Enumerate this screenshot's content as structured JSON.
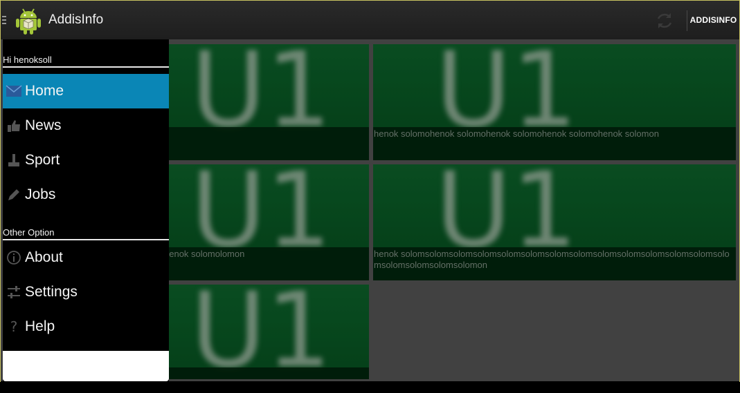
{
  "app": {
    "title": "AddisInfo",
    "action_button": "ADDISINFO"
  },
  "drawer": {
    "greeting": "Hi henoksoll",
    "main_items": [
      {
        "label": "Home",
        "icon": "mail-icon",
        "active": true
      },
      {
        "label": "News",
        "icon": "thumbs-up-icon",
        "active": false
      },
      {
        "label": "Sport",
        "icon": "joystick-icon",
        "active": false
      },
      {
        "label": "Jobs",
        "icon": "pencil-icon",
        "active": false
      }
    ],
    "other_header": "Other Option",
    "other_items": [
      {
        "label": "About",
        "icon": "info-icon"
      },
      {
        "label": "Settings",
        "icon": "sliders-icon"
      },
      {
        "label": "Help",
        "icon": "question-icon"
      }
    ]
  },
  "cards": [
    {
      "caption": ""
    },
    {
      "caption": "henok solomohenok solomohenok solomohenok solomohenok solomon"
    },
    {
      "caption": "henok solomolomon"
    },
    {
      "caption": "henok solomsolomsolomsolomsolomsolomsolomsolomsolomsolomsolomsolomsolomsolomsolomsolomsolomsolomon"
    },
    {
      "caption": ""
    }
  ],
  "colors": {
    "accent": "#0a86b6",
    "card_green": "#0a6329",
    "background": "#5a5a5a"
  }
}
